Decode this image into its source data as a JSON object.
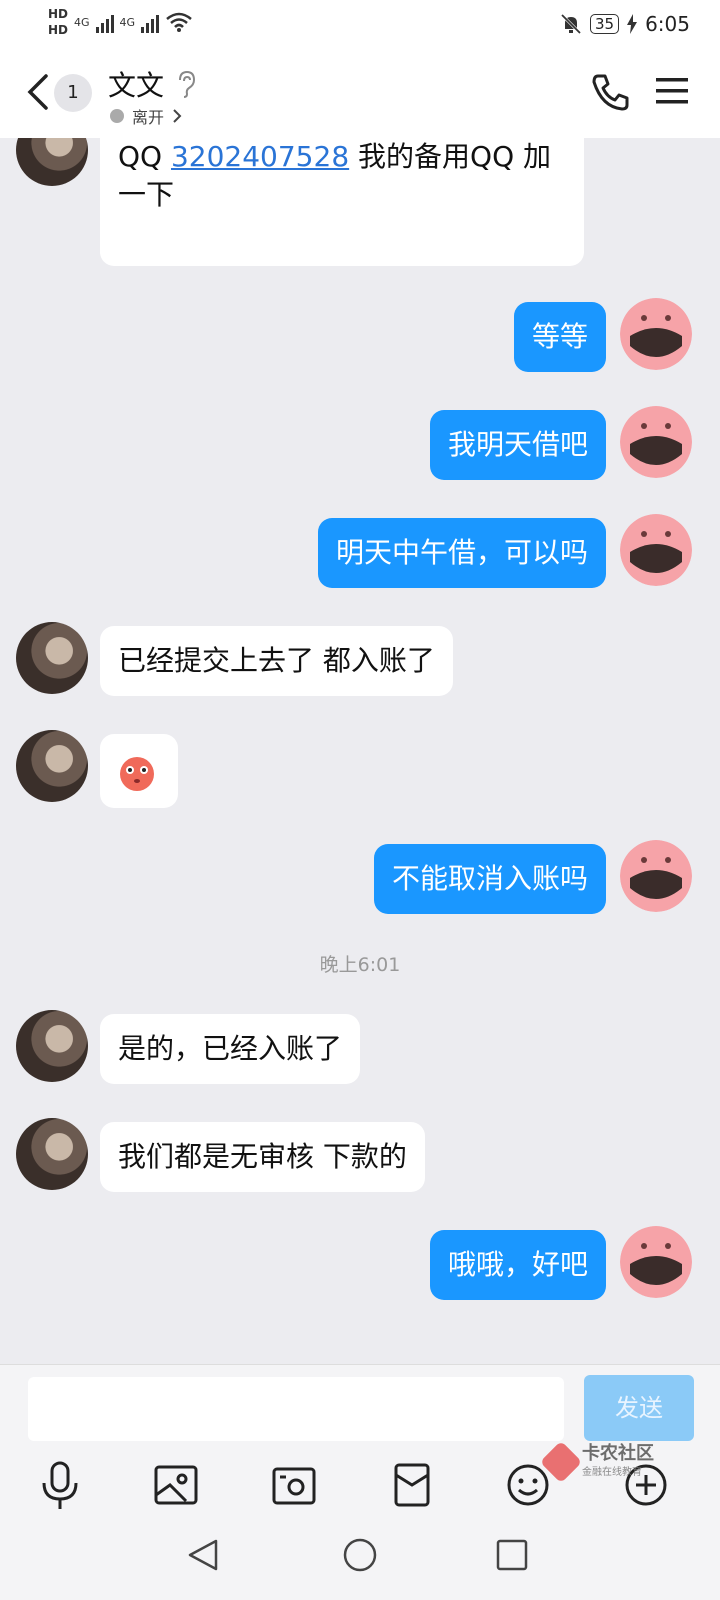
{
  "status_bar": {
    "hd1": "HD",
    "hd2": "HD",
    "net1": "4G",
    "net2": "4G",
    "battery": "35",
    "time": "6:05"
  },
  "header": {
    "unread_count": "1",
    "contact_name": "文文",
    "presence": "离开"
  },
  "messages": [
    {
      "side": "in",
      "qq_label": "QQ",
      "qq_number": "3202407528",
      "line1_suffix": "我的备用QQ 加",
      "line2": "一下"
    },
    {
      "side": "out",
      "text": "等等"
    },
    {
      "side": "out",
      "text": "我明天借吧"
    },
    {
      "side": "out",
      "text": "明天中午借，可以吗"
    },
    {
      "side": "in",
      "text": "已经提交上去了 都入账了"
    },
    {
      "side": "in",
      "emoji": "blushing-face"
    },
    {
      "side": "out",
      "text": "不能取消入账吗"
    },
    {
      "side": "in",
      "text": "是的，已经入账了"
    },
    {
      "side": "in",
      "text": "我们都是无审核 下款的"
    },
    {
      "side": "out",
      "text": "哦哦，好吧"
    }
  ],
  "timestamp": "晚上6:01",
  "composer": {
    "input_value": "",
    "send_label": "发送"
  },
  "toolbar_icons": [
    "mic-icon",
    "image-icon",
    "camera-icon",
    "red-packet-icon",
    "emoji-icon",
    "plus-icon"
  ],
  "watermark": {
    "title": "卡农社区",
    "subtitle": "金融在线教育"
  },
  "colors": {
    "outgoing_bubble": "#1a97ff",
    "incoming_bubble": "#ffffff",
    "background": "#ececf0",
    "send_button": "#8bcaf7"
  }
}
